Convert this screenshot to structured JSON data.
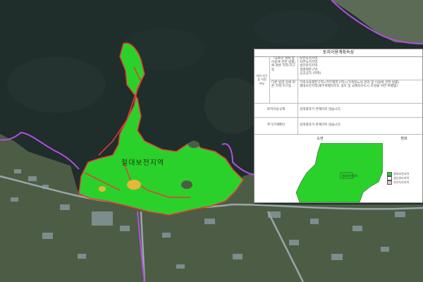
{
  "map": {
    "zone_label": "절대보전지역",
    "colors": {
      "sea": "#1f2d2b",
      "land": "#4a5f3a",
      "zone_fill": "#2bd12b",
      "zone_border": "#e8393a",
      "boundary": "#b050e0",
      "road": "#9aa6a8"
    }
  },
  "panel": {
    "title": "토지이용계획속성",
    "row1": {
      "header": "「국토의 계획 및 이용에 관한 법률」에 따른 지역·지구등",
      "value": "보전녹지지역\n자연녹지지역\n생산관리지역\n개발제한구역\n공공공지 (저촉)",
      "sub_header": "다른 법령 등에 따른 지역·지구등",
      "sub_value": "가축사육제한구역<전부제한구역>(가축분뇨의 관리 및 이용에 관한 법률)\n절대보전지역(제주특별자치도 설치 및 국제자유도시 조성을 위한 특별법)"
    },
    "row2": {
      "header": "토지이용규제",
      "value": "검색결과가 존재하지 않습니다."
    },
    "row3": {
      "header": "추가기재확인",
      "value": "검색결과가 존재하지 않습니다."
    },
    "map_header": "도면",
    "legend_header": "범례",
    "mini_map_label": "절대보전지역",
    "legend": [
      {
        "label": "절대보전지역",
        "color": "#2bd12b"
      },
      {
        "label": "생산관리지역",
        "color": "#ffffff"
      },
      {
        "label": "자연녹지지역",
        "color": "#f2c6c6"
      }
    ]
  }
}
